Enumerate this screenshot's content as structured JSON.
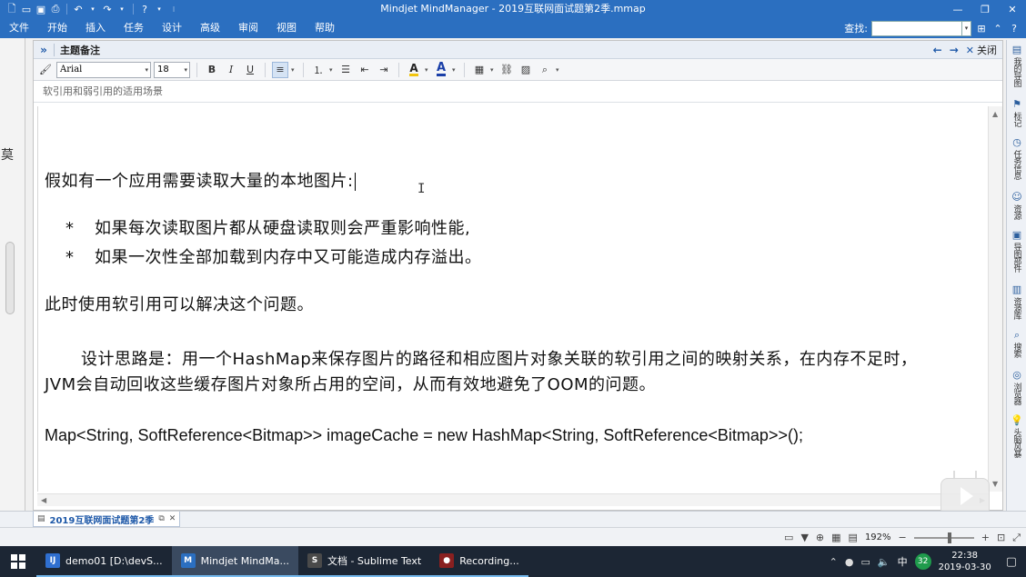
{
  "window": {
    "title": "Mindjet MindManager - 2019互联网面试题第2季.mmap",
    "quick_access": [
      "new-doc",
      "open-folder",
      "save",
      "print",
      "undo",
      "redo",
      "help",
      "customize"
    ],
    "minimize": "—",
    "restore": "❐",
    "close": "✕"
  },
  "menubar": {
    "items": [
      "文件",
      "开始",
      "插入",
      "任务",
      "设计",
      "高级",
      "审阅",
      "视图",
      "帮助"
    ],
    "search_label": "查找:",
    "search_value": ""
  },
  "notes": {
    "header_title": "主题备注",
    "close_label": "关闭",
    "font_name": "Arial",
    "font_size": "18",
    "topic_title": "软引用和弱引用的适用场景",
    "content": {
      "line1": "假如有一个应用需要读取大量的本地图片:",
      "bullet_marker": "*",
      "bullets": [
        "如果每次读取图片都从硬盘读取则会严重影响性能,",
        "如果一次性全部加载到内存中又可能造成内存溢出。"
      ],
      "line2": "此时使用软引用可以解决这个问题。",
      "para_line1": "设计思路是：用一个HashMap来保存图片的路径和相应图片对象关联的软引用之间的映射关系，在内存不足时，",
      "para_line2": "JVM会自动回收这些缓存图片对象所占用的空间，从而有效地避免了OOM的问题。",
      "code": "Map<String, SoftReference<Bitmap>> imageCache = new HashMap<String, SoftReference<Bitmap>>();"
    }
  },
  "right_panel": {
    "items": [
      {
        "label": "我的导图",
        "icon": "map-icon"
      },
      {
        "label": "标记",
        "icon": "tag-icon"
      },
      {
        "label": "任务信息",
        "icon": "clock-icon"
      },
      {
        "label": "资源",
        "icon": "people-icon"
      },
      {
        "label": "导图部件",
        "icon": "parts-icon"
      },
      {
        "label": "资源库",
        "icon": "library-icon"
      },
      {
        "label": "搜索",
        "icon": "search-icon"
      },
      {
        "label": "浏览器",
        "icon": "browser-icon"
      },
      {
        "label": "头脑风暴",
        "icon": "bulb-icon"
      }
    ]
  },
  "doc_tab": {
    "label": "2019互联网面试题第2季"
  },
  "statusbar": {
    "zoom": "192%",
    "zoom_level": 0.56
  },
  "taskbar": {
    "tasks": [
      {
        "label": "demo01 [D:\\devS...",
        "icon_color": "#2f6fd0"
      },
      {
        "label": "Mindjet MindMa...",
        "icon_color": "#2b6fc0"
      },
      {
        "label": "文档 - Sublime Text",
        "icon_color": "#4a4a4a"
      },
      {
        "label": "Recording...",
        "icon_color": "#8a2020"
      }
    ],
    "ime": "中",
    "badge": "32",
    "time": "22:38",
    "date": "2019-03-30"
  }
}
